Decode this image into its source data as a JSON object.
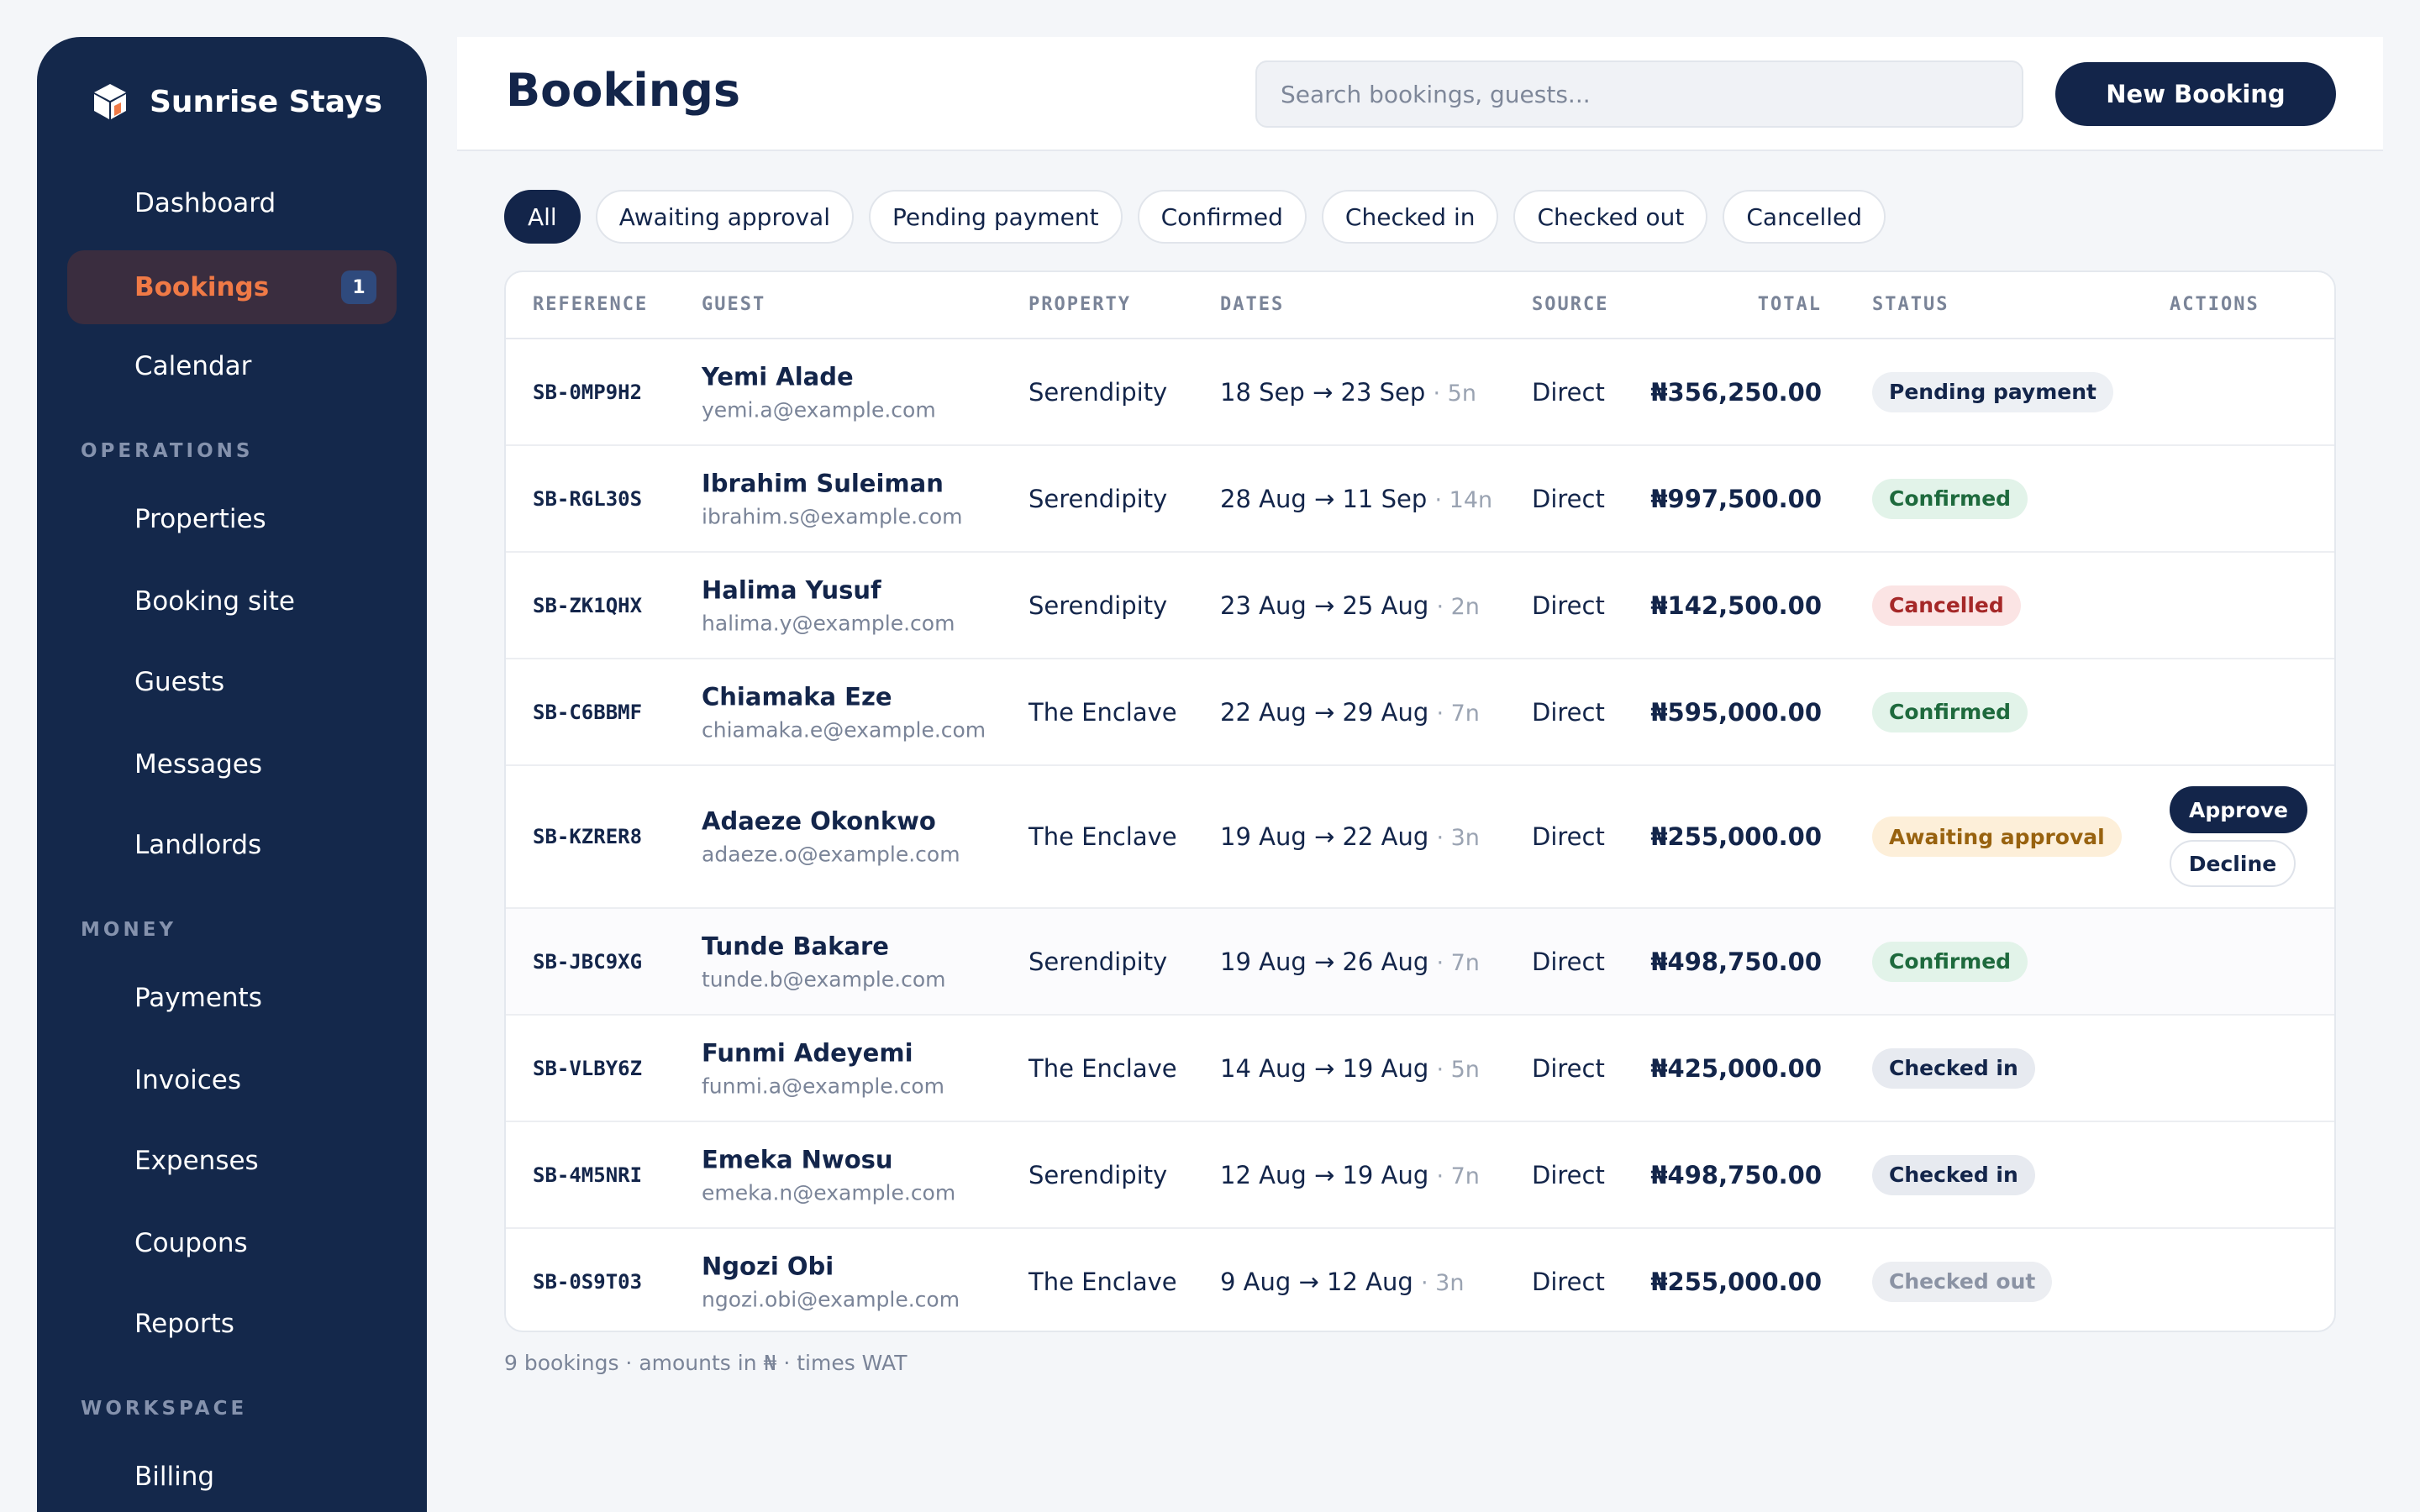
{
  "app": {
    "name": "Sunrise Stays",
    "logo_icon": "cube-logo-icon"
  },
  "sidebar": {
    "items": [
      {
        "label": "Dashboard"
      },
      {
        "label": "Bookings",
        "badge": "1",
        "active": true
      },
      {
        "label": "Calendar"
      },
      {
        "label": "Properties"
      },
      {
        "label": "Booking site"
      },
      {
        "label": "Guests"
      },
      {
        "label": "Messages"
      },
      {
        "label": "Landlords"
      },
      {
        "label": "Payments"
      },
      {
        "label": "Invoices"
      },
      {
        "label": "Expenses"
      },
      {
        "label": "Coupons"
      },
      {
        "label": "Reports"
      },
      {
        "label": "Billing"
      }
    ],
    "sections": [
      "OPERATIONS",
      "MONEY",
      "WORKSPACE"
    ]
  },
  "header": {
    "title": "Bookings",
    "search_placeholder": "Search bookings, guests...",
    "new_button": "New Booking"
  },
  "filters": [
    {
      "label": "All",
      "active": true
    },
    {
      "label": "Awaiting approval"
    },
    {
      "label": "Pending payment"
    },
    {
      "label": "Confirmed"
    },
    {
      "label": "Checked in"
    },
    {
      "label": "Checked out"
    },
    {
      "label": "Cancelled"
    }
  ],
  "table": {
    "columns": [
      "REFERENCE",
      "GUEST",
      "PROPERTY",
      "DATES",
      "SOURCE",
      "TOTAL",
      "STATUS",
      "ACTIONS"
    ],
    "rows": [
      {
        "ref": "SB-0MP9H2",
        "guest": "Yemi Alade",
        "email": "yemi.a@example.com",
        "property": "Serendipity",
        "dates": "18 Sep → 23 Sep",
        "nights": "· 5n",
        "source": "Direct",
        "total": "₦356,250.00",
        "status": "Pending payment"
      },
      {
        "ref": "SB-RGL30S",
        "guest": "Ibrahim Suleiman",
        "email": "ibrahim.s@example.com",
        "property": "Serendipity",
        "dates": "28 Aug → 11 Sep",
        "nights": "· 14n",
        "source": "Direct",
        "total": "₦997,500.00",
        "status": "Confirmed"
      },
      {
        "ref": "SB-ZK1QHX",
        "guest": "Halima Yusuf",
        "email": "halima.y@example.com",
        "property": "Serendipity",
        "dates": "23 Aug → 25 Aug",
        "nights": "· 2n",
        "source": "Direct",
        "total": "₦142,500.00",
        "status": "Cancelled"
      },
      {
        "ref": "SB-C6BBMF",
        "guest": "Chiamaka Eze",
        "email": "chiamaka.e@example.com",
        "property": "The Enclave",
        "dates": "22 Aug → 29 Aug",
        "nights": "· 7n",
        "source": "Direct",
        "total": "₦595,000.00",
        "status": "Confirmed"
      },
      {
        "ref": "SB-KZRER8",
        "guest": "Adaeze Okonkwo",
        "email": "adaeze.o@example.com",
        "property": "The Enclave",
        "dates": "19 Aug → 22 Aug",
        "nights": "· 3n",
        "source": "Direct",
        "total": "₦255,000.00",
        "status": "Awaiting approval",
        "approve": "Approve",
        "decline": "Decline"
      },
      {
        "ref": "SB-JBC9XG",
        "guest": "Tunde Bakare",
        "email": "tunde.b@example.com",
        "property": "Serendipity",
        "dates": "19 Aug → 26 Aug",
        "nights": "· 7n",
        "source": "Direct",
        "total": "₦498,750.00",
        "status": "Confirmed"
      },
      {
        "ref": "SB-VLBY6Z",
        "guest": "Funmi Adeyemi",
        "email": "funmi.a@example.com",
        "property": "The Enclave",
        "dates": "14 Aug → 19 Aug",
        "nights": "· 5n",
        "source": "Direct",
        "total": "₦425,000.00",
        "status": "Checked in"
      },
      {
        "ref": "SB-4M5NRI",
        "guest": "Emeka Nwosu",
        "email": "emeka.n@example.com",
        "property": "Serendipity",
        "dates": "12 Aug → 19 Aug",
        "nights": "· 7n",
        "source": "Direct",
        "total": "₦498,750.00",
        "status": "Checked in"
      },
      {
        "ref": "SB-0S9T03",
        "guest": "Ngozi Obi",
        "email": "ngozi.obi@example.com",
        "property": "The Enclave",
        "dates": "9 Aug → 12 Aug",
        "nights": "· 3n",
        "source": "Direct",
        "total": "₦255,000.00",
        "status": "Checked out"
      }
    ]
  },
  "footer": "9 bookings · amounts in ₦ · times WAT"
}
